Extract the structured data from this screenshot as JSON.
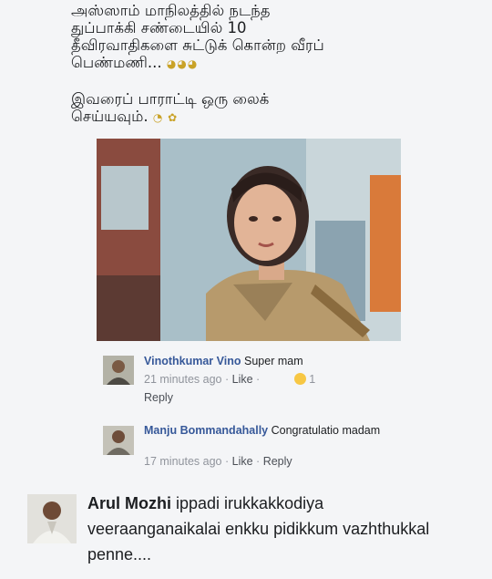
{
  "caption": {
    "line1": "அஸ்ஸாம் மாநிலத்தில் நடந்த",
    "line2": "துப்பாக்கி சண்டையில் 10",
    "line3": "தீவிரவாதிகளை சுட்டுக் கொன்ற வீரப்",
    "line4": "பெண்மணி...",
    "line5": "இவரைப் பாராட்டி ஒரு லைக்",
    "line6": "செய்யவும்.",
    "emoji1": "◕◕◕",
    "emoji2": "◔ ✿"
  },
  "comments": [
    {
      "name": "Vinothkumar Vino",
      "text": "Super mam",
      "time": "21 minutes ago",
      "dot": "·",
      "like": "Like",
      "reply": "Reply",
      "reaction_count": "1"
    },
    {
      "name": "Manju Bommandahally",
      "text": "Congratulatio madam",
      "time": "17 minutes ago",
      "dot": "·",
      "like": "Like",
      "reply": "Reply"
    },
    {
      "name": "Arul Mozhi",
      "text": "ippadi irukkakkodiya veeraanganaikalai  enkku pidikkum vazhthukkal penne...."
    }
  ],
  "icons": {
    "avatar": "person-photo",
    "reaction": "laughing-emoji-icon"
  }
}
